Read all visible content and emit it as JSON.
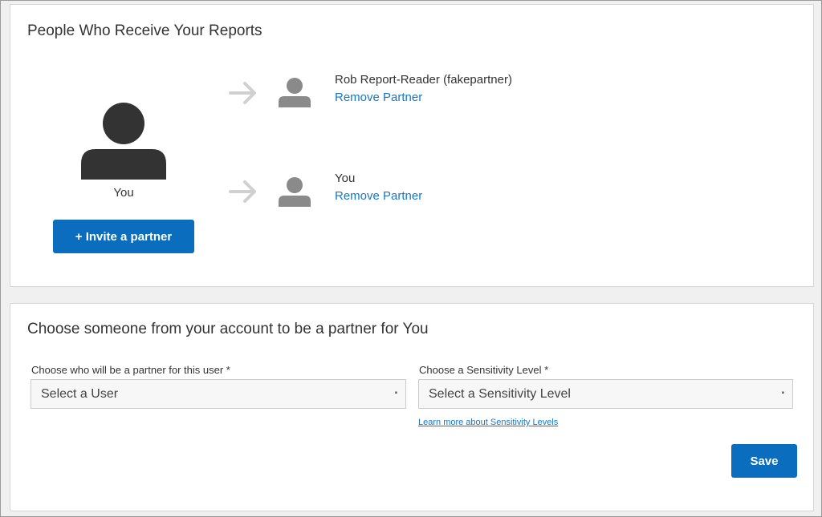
{
  "reports_panel": {
    "title": "People Who Receive Your Reports",
    "you_label": "You",
    "invite_button_label": "+ Invite a partner",
    "partners": [
      {
        "name": "Rob Report-Reader (fakepartner)",
        "remove_label": "Remove Partner"
      },
      {
        "name": "You",
        "remove_label": "Remove Partner"
      }
    ],
    "icons": {
      "self_avatar": "user-icon",
      "partner_avatar": "user-icon",
      "arrow": "arrow-right-icon"
    }
  },
  "choose_panel": {
    "title": "Choose someone from your account to be a partner for You",
    "user_field": {
      "label": "Choose who will be a partner for this user *",
      "value": "Select a User"
    },
    "sensitivity_field": {
      "label": "Choose a Sensitivity Level *",
      "value": "Select a Sensitivity Level"
    },
    "learn_more_label": "Learn more about Sensitivity Levels",
    "save_label": "Save"
  },
  "colors": {
    "primary_button": "#0a6dbd",
    "link": "#1776c4",
    "big_avatar": "#333333",
    "small_avatar": "#8a8a8a",
    "arrow": "#d0d0d0"
  }
}
